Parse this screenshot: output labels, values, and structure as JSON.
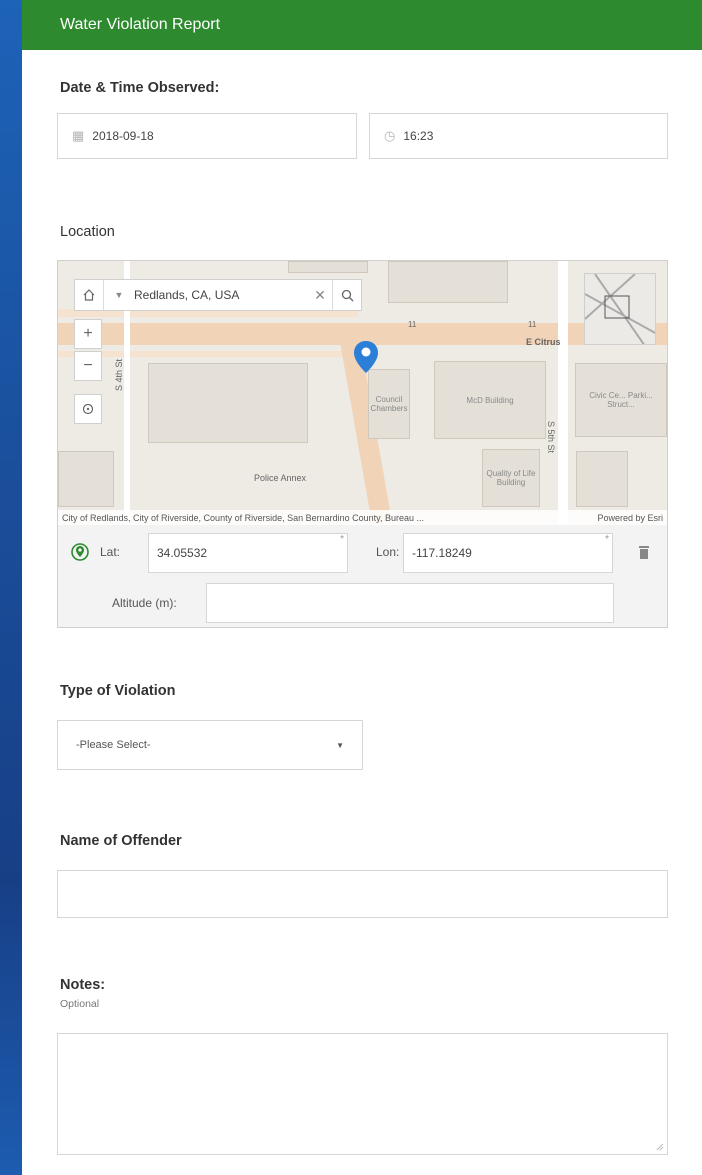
{
  "header": {
    "title": "Water Violation Report"
  },
  "date_time": {
    "label": "Date & Time Observed:",
    "date_value": "2018-09-18",
    "time_value": "16:23"
  },
  "location": {
    "label": "Location",
    "search_value": "Redlands, CA, USA",
    "map_labels": {
      "street_citrus": "E Citrus",
      "council": "Council Chambers",
      "mcd": "McD Building",
      "civic": "Civic Ce... Parki... Struct...",
      "quality": "Quality of Life Building",
      "police": "Police Annex",
      "st4": "S 4th St",
      "st5": "S 5th St",
      "num11a": "11",
      "num11b": "11"
    },
    "attribution": "City of Redlands, City of Riverside, County of Riverside, San Bernardino County, Bureau ...",
    "powered_by": "Powered by Esri",
    "lat_label": "Lat:",
    "lat_value": "34.05532",
    "lon_label": "Lon:",
    "lon_value": "-117.18249",
    "altitude_label": "Altitude (m):",
    "altitude_value": ""
  },
  "violation": {
    "label": "Type of Violation",
    "selected": "-Please Select-"
  },
  "offender": {
    "label": "Name of Offender",
    "value": ""
  },
  "notes": {
    "label": "Notes:",
    "hint": "Optional",
    "value": ""
  },
  "colors": {
    "header_bg": "#2e8a2e",
    "pin": "#2b7fd6",
    "gps_icon": "#2e8a2e"
  }
}
